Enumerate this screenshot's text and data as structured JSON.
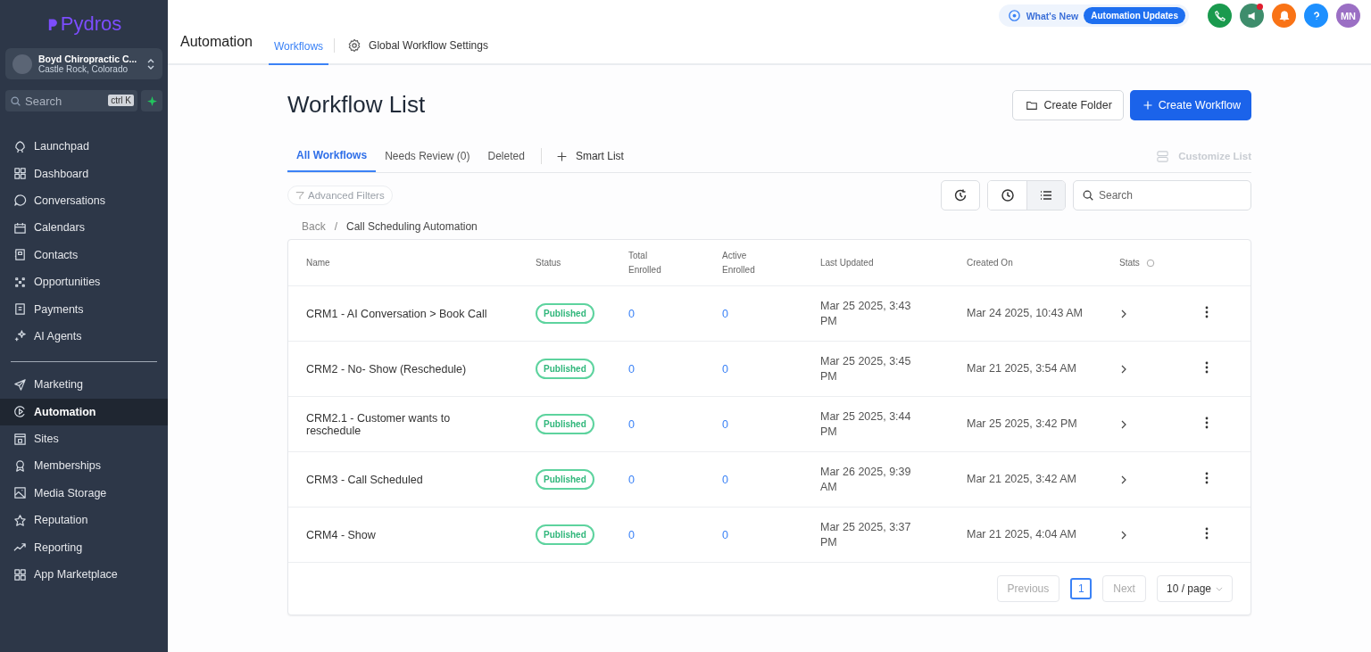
{
  "sidebar": {
    "logo": "Pydros",
    "account": {
      "name": "Boyd Chiropractic C...",
      "location": "Castle Rock, Colorado"
    },
    "search": {
      "placeholder": "Search",
      "shortcut": "ctrl K"
    },
    "groups": [
      [
        {
          "label": "Launchpad",
          "selected": false
        },
        {
          "label": "Dashboard",
          "selected": false
        },
        {
          "label": "Conversations",
          "selected": false
        },
        {
          "label": "Calendars",
          "selected": false
        },
        {
          "label": "Contacts",
          "selected": false
        },
        {
          "label": "Opportunities",
          "selected": false
        },
        {
          "label": "Payments",
          "selected": false
        },
        {
          "label": "AI Agents",
          "selected": false
        }
      ],
      [
        {
          "label": "Marketing",
          "selected": false
        },
        {
          "label": "Automation",
          "selected": true
        },
        {
          "label": "Sites",
          "selected": false
        },
        {
          "label": "Memberships",
          "selected": false
        },
        {
          "label": "Media Storage",
          "selected": false
        },
        {
          "label": "Reputation",
          "selected": false
        },
        {
          "label": "Reporting",
          "selected": false
        },
        {
          "label": "App Marketplace",
          "selected": false
        }
      ]
    ]
  },
  "header": {
    "title": "Automation",
    "tabs": [
      {
        "label": "Workflows",
        "selected": true
      },
      {
        "label": "Global Workflow Settings",
        "selected": false
      }
    ],
    "whats_new": "What's New",
    "updates_badge": "Automation Updates",
    "avatar": "MN"
  },
  "page": {
    "title": "Workflow List",
    "buttons": {
      "secondary": "Create Folder",
      "primary": "Create Workflow"
    },
    "tabs": [
      {
        "label": "All Workflows",
        "selected": true
      },
      {
        "label": "Needs Review (0)",
        "selected": false
      },
      {
        "label": "Deleted",
        "selected": false
      }
    ],
    "smart_list": "Smart List",
    "customize": {
      "label": "Customize List",
      "disabled": true
    },
    "filters": "Advanced Filters",
    "views": [
      {
        "kind": "clock",
        "selected": false
      },
      {
        "kind": "list",
        "selected": true
      }
    ],
    "search": {
      "placeholder": "Search"
    },
    "breadcrumb": {
      "back": "Back",
      "separator": "/",
      "current": "Call Scheduling Automation"
    }
  },
  "table": {
    "columns": [
      "Name",
      "Status",
      "Total Enrolled",
      "Active Enrolled",
      "Last Updated",
      "Created On",
      "Stats"
    ],
    "rows": [
      {
        "name": "CRM1 - AI Conversation > Book Call",
        "status": "Published",
        "total": "0",
        "active": "0",
        "updated": "Mar 25 2025, 3:43 PM",
        "created": "Mar 24 2025, 10:43 AM"
      },
      {
        "name": "CRM2 - No- Show (Reschedule)",
        "status": "Published",
        "total": "0",
        "active": "0",
        "updated": "Mar 25 2025, 3:45 PM",
        "created": "Mar 21 2025, 3:54 AM"
      },
      {
        "name": "CRM2.1 - Customer wants to reschedule",
        "status": "Published",
        "total": "0",
        "active": "0",
        "updated": "Mar 25 2025, 3:44 PM",
        "created": "Mar 25 2025, 3:42 PM"
      },
      {
        "name": "CRM3 - Call Scheduled",
        "status": "Published",
        "total": "0",
        "active": "0",
        "updated": "Mar 26 2025, 9:39 AM",
        "created": "Mar 21 2025, 3:42 AM"
      },
      {
        "name": "CRM4 - Show",
        "status": "Published",
        "total": "0",
        "active": "0",
        "updated": "Mar 25 2025, 3:37 PM",
        "created": "Mar 21 2025, 4:04 AM"
      }
    ]
  },
  "pagination": {
    "previous": "Previous",
    "pages": [
      {
        "label": "1",
        "selected": true
      }
    ],
    "next": "Next",
    "page_size": "10 / page"
  }
}
